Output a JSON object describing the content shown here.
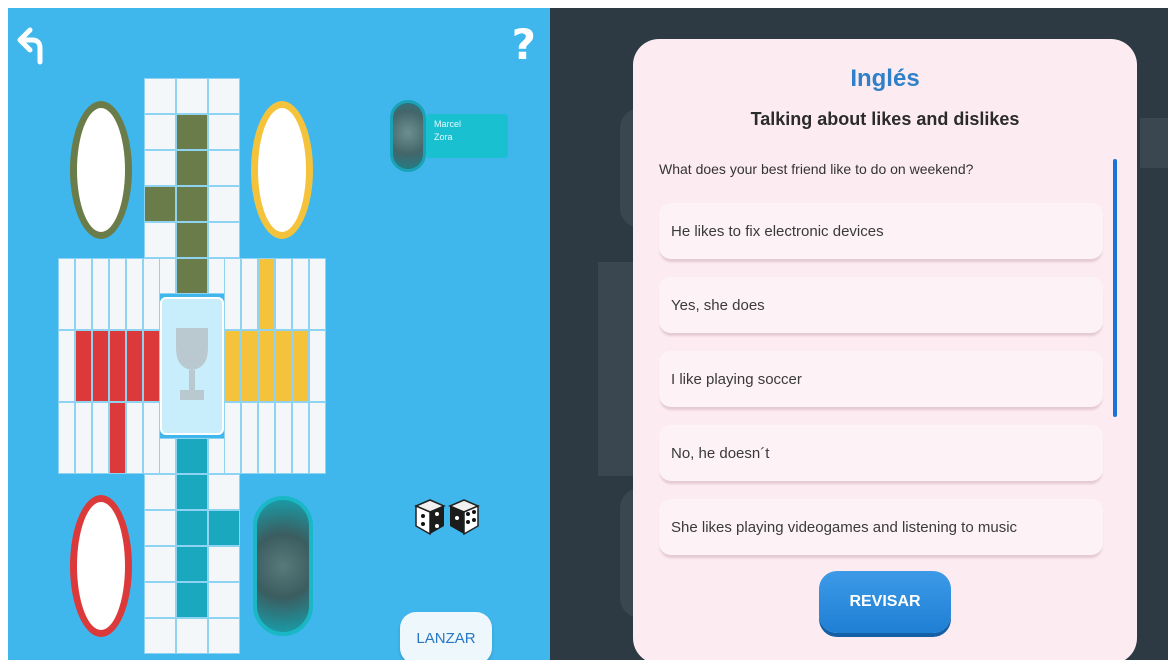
{
  "game": {
    "help_label": "?",
    "player": {
      "name_line1": "Marcel",
      "name_line2": "Zora"
    },
    "launch_label": "LANZAR",
    "colors": {
      "background": "#3fb6ec",
      "green": "#6a7c4a",
      "yellow": "#f5c33b",
      "red": "#dc3a3a",
      "teal": "#19a8bd"
    }
  },
  "modal": {
    "subject": "Inglés",
    "topic": "Talking about likes and dislikes",
    "question": "What does your best friend like to do on weekend?",
    "options": [
      "He likes to fix electronic devices",
      "Yes, she does",
      "I like playing soccer",
      "No, he doesn´t",
      "She likes playing videogames and listening to music"
    ],
    "review_label": "REVISAR",
    "colors": {
      "background": "#fcecf1",
      "accent": "#2f80c8",
      "button": "#1f7fd3"
    }
  }
}
